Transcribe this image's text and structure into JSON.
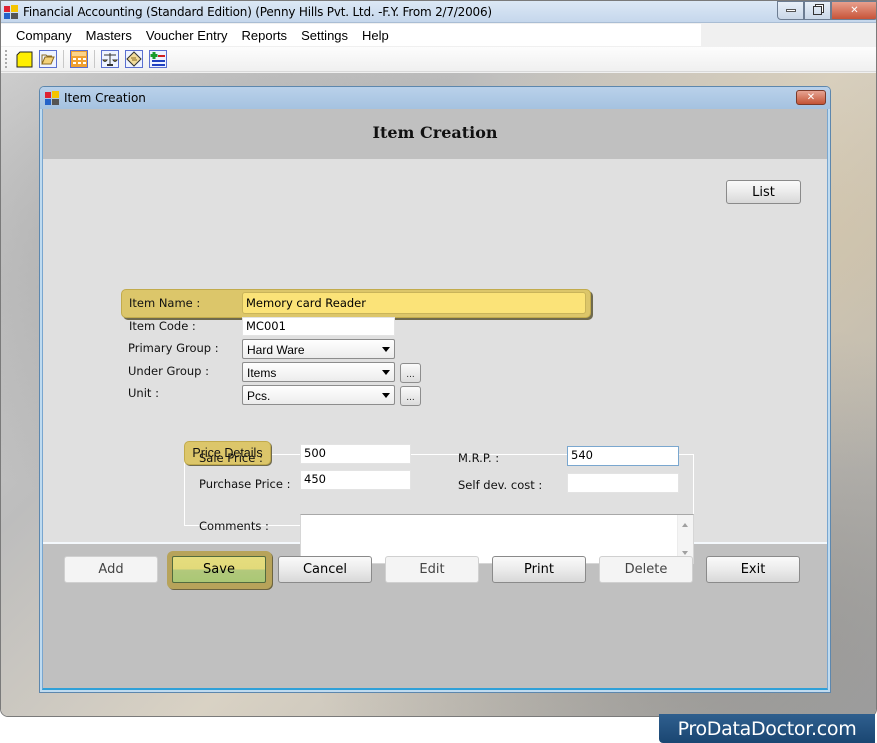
{
  "window": {
    "title": "Financial Accounting (Standard Edition) (Penny Hills Pvt. Ltd. -F.Y. From 2/7/2006)",
    "controls": {
      "minimize": "minimize",
      "restore": "restore",
      "close": "close"
    }
  },
  "menubar": {
    "items": [
      {
        "label": "Company"
      },
      {
        "label": "Masters"
      },
      {
        "label": "Voucher Entry"
      },
      {
        "label": "Reports"
      },
      {
        "label": "Settings"
      },
      {
        "label": "Help"
      }
    ]
  },
  "toolbar": {
    "icons": [
      "new-company-icon",
      "open-company-icon",
      "calculator-icon",
      "balance-scale-icon",
      "ledger-icon",
      "add-item-icon"
    ]
  },
  "dialog": {
    "title": "Item Creation",
    "header": "Item Creation",
    "list_button": "List",
    "form": {
      "item_name": {
        "label": "Item Name :",
        "value": "Memory card Reader"
      },
      "item_code": {
        "label": "Item Code :",
        "value": "MC001"
      },
      "primary_group": {
        "label": "Primary Group :",
        "value": "Hard Ware"
      },
      "under_group": {
        "label": "Under Group :",
        "value": "Items",
        "more": "..."
      },
      "unit": {
        "label": "Unit :",
        "value": "Pcs.",
        "more": "..."
      }
    },
    "price_details": {
      "legend": "Price Details",
      "sale_price": {
        "label": "Sale Price :",
        "value": "500"
      },
      "purchase_price": {
        "label": "Purchase Price :",
        "value": "450"
      },
      "mrp": {
        "label": "M.R.P. :",
        "value": "540"
      },
      "self_dev_cost": {
        "label": "Self dev. cost :",
        "value": ""
      }
    },
    "comments": {
      "label": "Comments :",
      "value": ""
    },
    "buttons": {
      "add": "Add",
      "save": "Save",
      "cancel": "Cancel",
      "edit": "Edit",
      "print": "Print",
      "delete": "Delete",
      "exit": "Exit"
    }
  },
  "branding": {
    "text": "ProDataDoctor.com"
  }
}
